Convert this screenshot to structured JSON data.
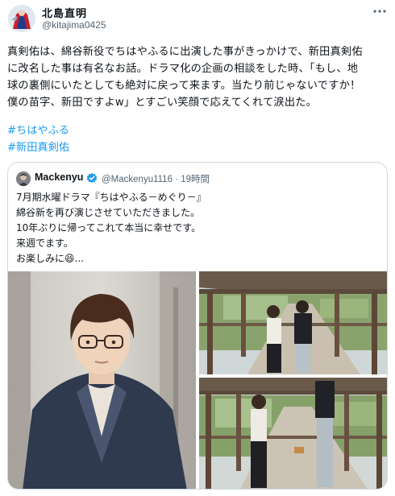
{
  "author": {
    "name": "北島直明",
    "handle": "@kitajima0425"
  },
  "tweet": {
    "lines": [
      "真剣佑は、綿谷新役でちはやふるに出演した事がきっかけで、新田真剣佑",
      "に改名した事は有名なお話。ドラマ化の企画の相談をした時、「もし、地",
      "球の裏側にいたとしても絶対に戻って来ます。当たり前じゃないですか！",
      "僕の苗字、新田ですよw」とすごい笑顔で応えてくれて涙出た。"
    ],
    "hashtags": [
      "#ちはやふる",
      "#新田真剣佑"
    ]
  },
  "quote": {
    "name": "Mackenyu",
    "handle": "@Mackenyu1116",
    "separator": "·",
    "time": "19時間",
    "lines": [
      "7月期水曜ドラマ『ちはやふる－めぐり－』",
      "綿谷新を再び演じさせていただきました。",
      "10年ぶりに帰ってこれて本当に幸せです。",
      "来週でます。",
      "お楽しみに😆..."
    ]
  },
  "icons": {
    "more": "more-dots-icon",
    "verified": "verified-badge-icon"
  },
  "colors": {
    "link": "#1d9bf0",
    "secondary_text": "#536471",
    "verified": "#1d9bf0",
    "border": "#cfd9de"
  }
}
